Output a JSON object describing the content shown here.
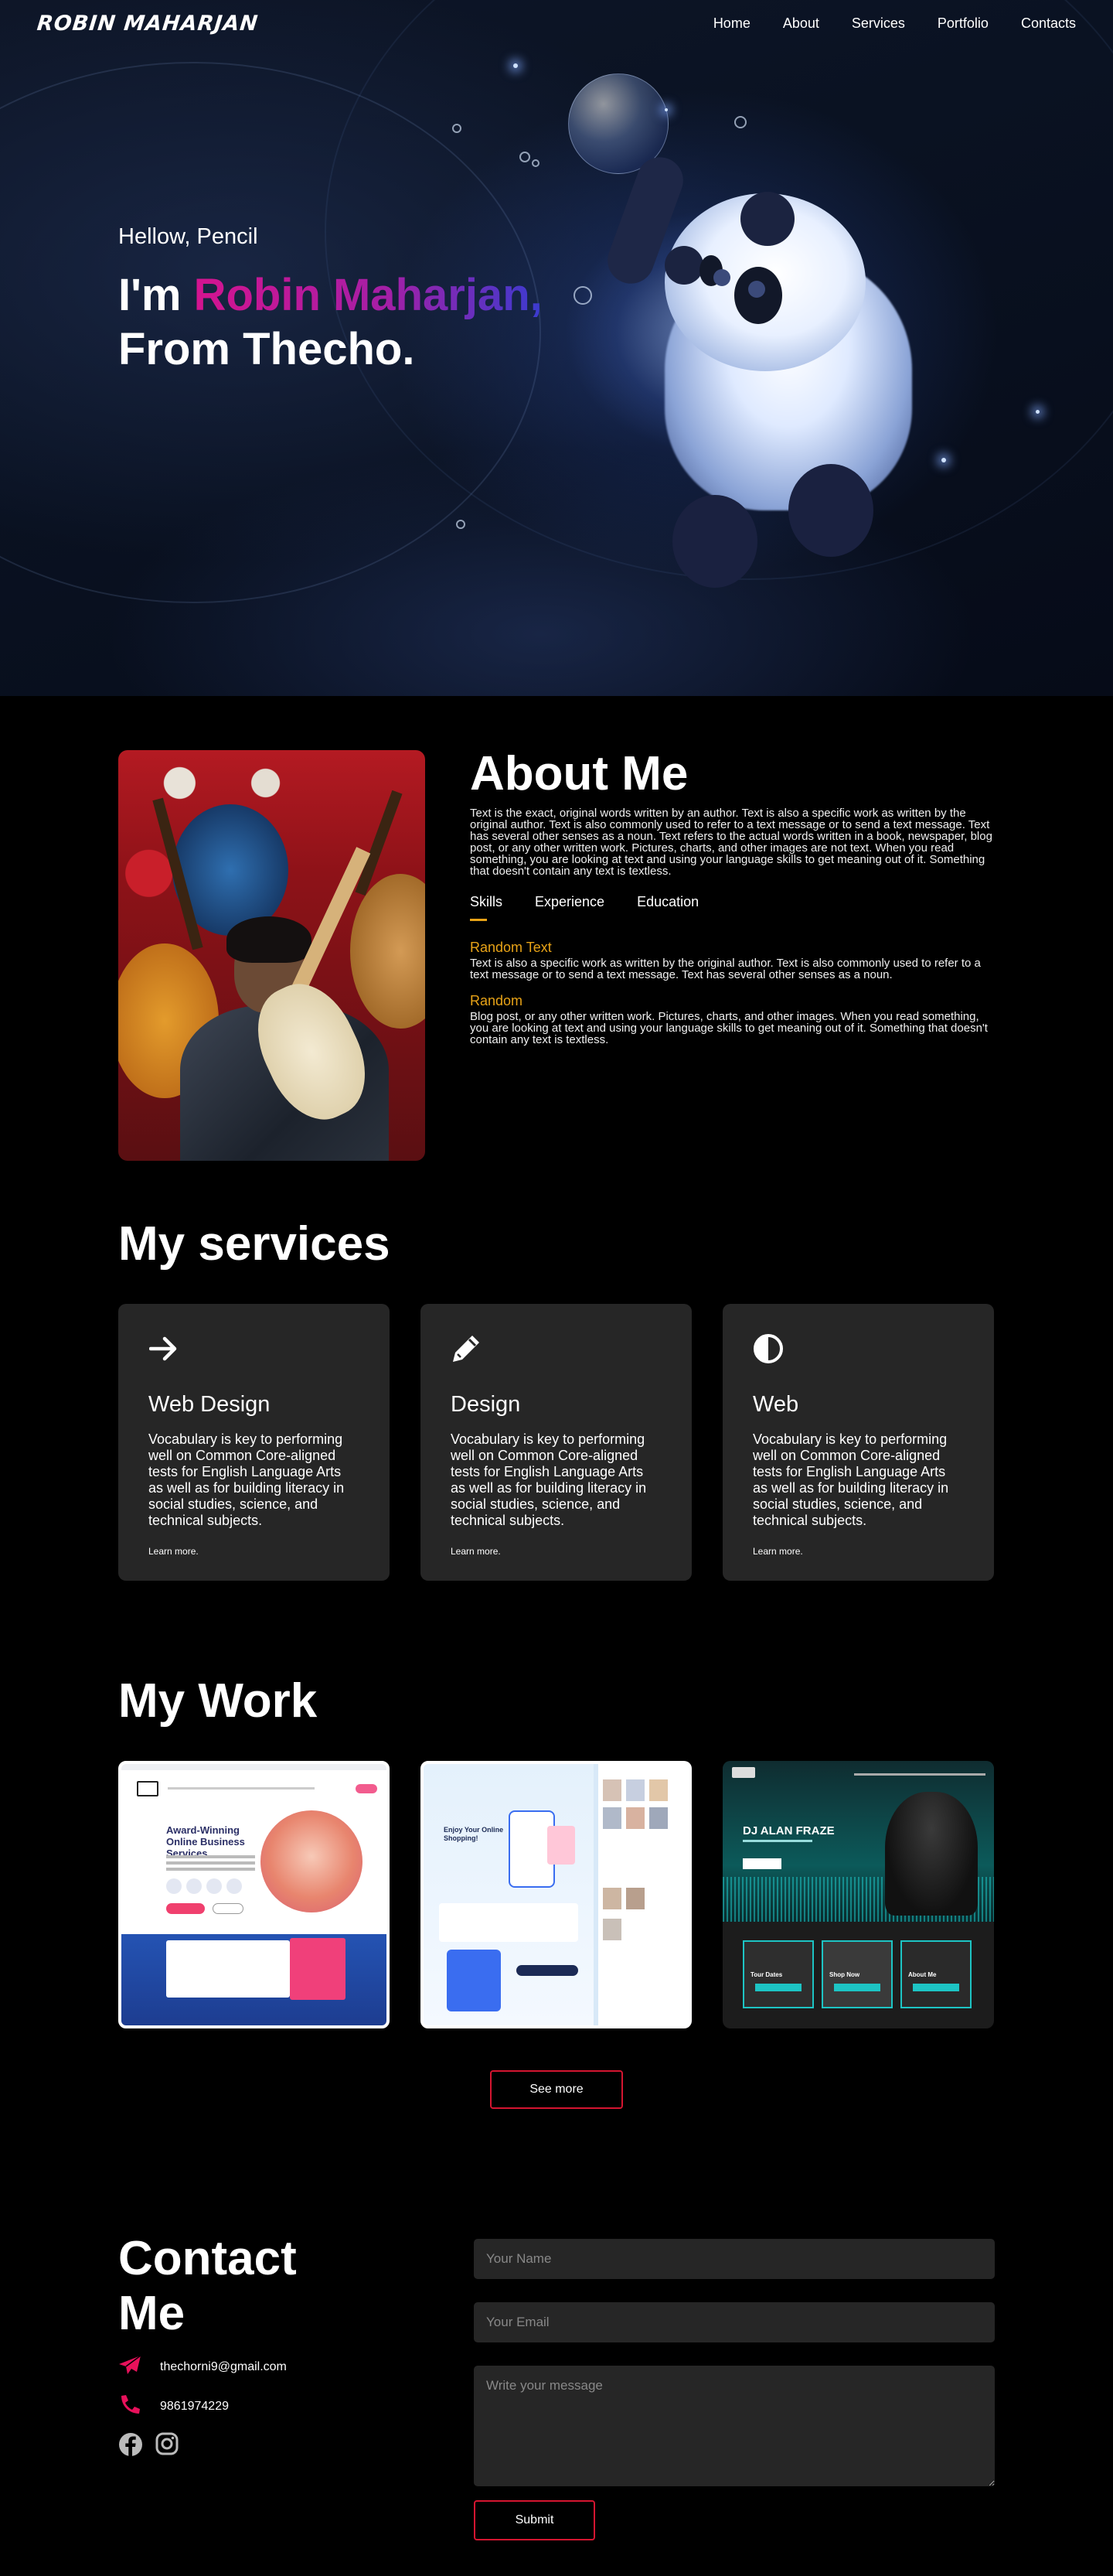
{
  "brand": "ROBIN MAHARJAN",
  "nav": [
    "Home",
    "About",
    "Services",
    "Portfolio",
    "Contacts"
  ],
  "hero": {
    "greeting": "Hellow, Pencil",
    "intro_prefix": "I'm ",
    "name": "Robin Maharjan,",
    "from_line": "From Thecho."
  },
  "about": {
    "title": "About Me",
    "description": "Text is the exact, original words written by an author. Text is also a specific work as written by the original author. Text is also commonly used to refer to a text message or to send a text message. Text has several other senses as a noun. Text refers to the actual words written in a book, newspaper, blog post, or any other written work. Pictures, charts, and other images are not text. When you read something, you are looking at text and using your language skills to get meaning out of it. Something that doesn't contain any text is textless.",
    "tabs": [
      {
        "label": "Skills",
        "active": true
      },
      {
        "label": "Experience",
        "active": false
      },
      {
        "label": "Education",
        "active": false
      }
    ],
    "items": [
      {
        "title": "Random Text",
        "text": "Text is also a specific work as written by the original author. Text is also commonly used to refer to a text message or to send a text message. Text has several other senses as a noun."
      },
      {
        "title": "Random",
        "text": "Blog post, or any other written work. Pictures, charts, and other images. When you read something, you are looking at text and using your language skills to get meaning out of it. Something that doesn't contain any text is textless."
      }
    ]
  },
  "services": {
    "title": "My services",
    "cards": [
      {
        "icon": "arrow-right-icon",
        "title": "Web Design",
        "text": "Vocabulary is key to performing well on Common Core-aligned tests for English Language Arts as well as for building literacy in social studies, science, and technical subjects.",
        "link": "Learn more."
      },
      {
        "icon": "pencil-icon",
        "title": "Design",
        "text": "Vocabulary is key to performing well on Common Core-aligned tests for English Language Arts as well as for building literacy in social studies, science, and technical subjects.",
        "link": "Learn more."
      },
      {
        "icon": "half-circle-icon",
        "title": "Web",
        "text": "Vocabulary is key to performing well on Common Core-aligned tests for English Language Arts as well as for building literacy in social studies, science, and technical subjects.",
        "link": "Learn more."
      }
    ]
  },
  "work": {
    "title": "My Work",
    "items": [
      {
        "headline": "Award-Winning Online Business Services",
        "theme": "white-blue"
      },
      {
        "headline": "Enjoy Your Online Shopping!",
        "theme": "light-blue"
      },
      {
        "headline": "DJ ALAN FRAZE",
        "theme": "dark-teal",
        "tiles": [
          "Tour Dates",
          "Shop Now",
          "About Me"
        ]
      }
    ],
    "see_more": "See more"
  },
  "contact": {
    "title": "Contact Me",
    "email": "thechorni9@gmail.com",
    "phone": "9861974229",
    "socials": [
      "facebook-icon",
      "instagram-icon"
    ],
    "form": {
      "name_placeholder": "Your Name",
      "email_placeholder": "Your Email",
      "message_placeholder": "Write your message",
      "submit": "Submit"
    }
  },
  "colors": {
    "accent_orange": "#e8a317",
    "accent_red": "#d41530",
    "card_bg": "#262626",
    "gradient": [
      "#d4148f",
      "#a51fa6",
      "#3a3bd0"
    ]
  }
}
